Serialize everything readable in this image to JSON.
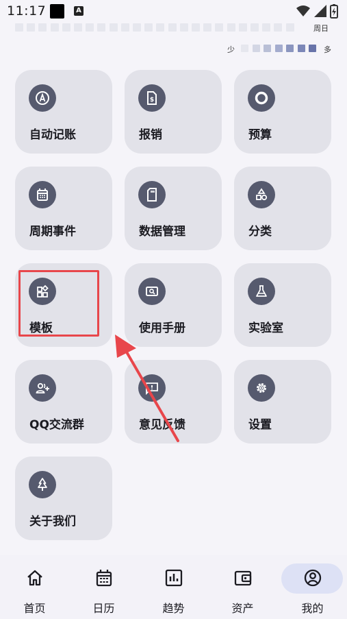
{
  "status_bar": {
    "time": "11:17",
    "a_icon": "A"
  },
  "heatmap": {
    "day_label": "周日",
    "legend_less": "少",
    "legend_more": "多",
    "legend_colors": [
      "#e6e7ee",
      "#d3d6e4",
      "#b9bfd6",
      "#a4acce",
      "#8b95bf",
      "#7c87b8",
      "#6873a9"
    ]
  },
  "tiles": [
    {
      "label": "自动记账",
      "icon": "auto-bookkeeping-icon"
    },
    {
      "label": "报销",
      "icon": "reimburse-icon"
    },
    {
      "label": "预算",
      "icon": "budget-ring-icon"
    },
    {
      "label": "周期事件",
      "icon": "calendar-icon"
    },
    {
      "label": "数据管理",
      "icon": "sd-card-icon"
    },
    {
      "label": "分类",
      "icon": "shapes-icon"
    },
    {
      "label": "模板",
      "icon": "widgets-icon"
    },
    {
      "label": "使用手册",
      "icon": "search-manual-icon"
    },
    {
      "label": "实验室",
      "icon": "flask-icon"
    },
    {
      "label": "QQ交流群",
      "icon": "group-add-icon"
    },
    {
      "label": "意见反馈",
      "icon": "feedback-icon"
    },
    {
      "label": "设置",
      "icon": "gear-icon"
    },
    {
      "label": "关于我们",
      "icon": "tree-icon"
    }
  ],
  "bottom_nav": [
    {
      "label": "首页",
      "icon": "home-icon",
      "active": false
    },
    {
      "label": "日历",
      "icon": "calendar-icon",
      "active": false
    },
    {
      "label": "趋势",
      "icon": "chart-icon",
      "active": false
    },
    {
      "label": "资产",
      "icon": "wallet-icon",
      "active": false
    },
    {
      "label": "我的",
      "icon": "account-icon",
      "active": true
    }
  ],
  "colors": {
    "tile_bg": "#e2e2e9",
    "icon_circle": "#565a6e",
    "annotation_red": "#e8464b",
    "active_pill": "#dde1f5"
  }
}
